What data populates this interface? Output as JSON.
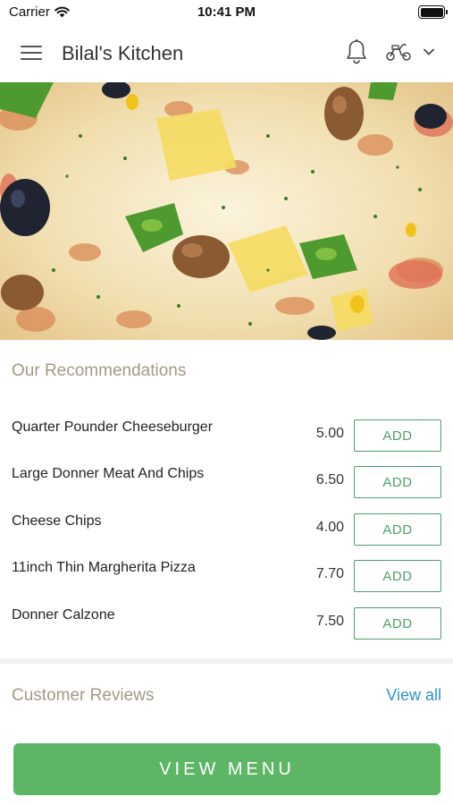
{
  "status_bar": {
    "carrier": "Carrier",
    "time": "10:41 PM"
  },
  "header": {
    "title": "Bilal's Kitchen",
    "icons": [
      "hamburger-menu-icon",
      "bell-icon",
      "moped-icon",
      "chevron-down-icon"
    ]
  },
  "recommendations": {
    "title": "Our Recommendations",
    "add_label": "ADD",
    "items": [
      {
        "name": "Quarter Pounder Cheeseburger",
        "price": "5.00"
      },
      {
        "name": "Large Donner Meat And Chips",
        "price": "6.50"
      },
      {
        "name": "Cheese Chips",
        "price": "4.00"
      },
      {
        "name": "11inch Thin Margherita Pizza",
        "price": "7.70"
      },
      {
        "name": "Donner Calzone",
        "price": "7.50"
      }
    ]
  },
  "reviews": {
    "title": "Customer Reviews",
    "view_all": "View all"
  },
  "footer": {
    "view_menu": "VIEW MENU"
  },
  "colors": {
    "accent_green": "#5cb666",
    "add_green": "#4e9e69",
    "section_title": "#a39a86",
    "link_blue": "#2e95c8"
  }
}
